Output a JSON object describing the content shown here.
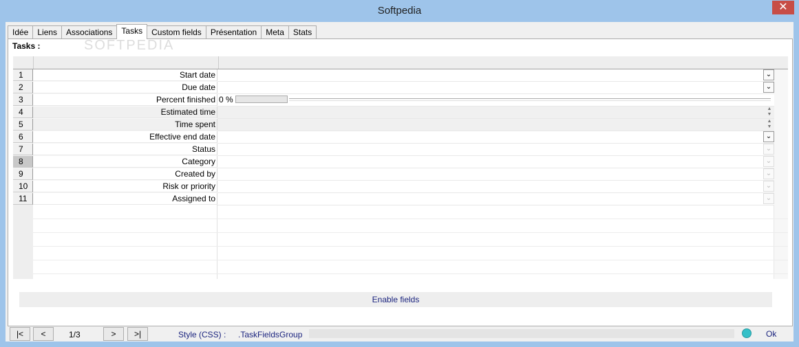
{
  "window": {
    "title": "Softpedia",
    "close": "✕"
  },
  "watermark": "SOFTPEDIA",
  "tabs": [
    {
      "label": "Idée"
    },
    {
      "label": "Liens"
    },
    {
      "label": "Associations"
    },
    {
      "label": "Tasks",
      "active": true
    },
    {
      "label": "Custom fields"
    },
    {
      "label": "Présentation"
    },
    {
      "label": "Meta"
    },
    {
      "label": "Stats"
    }
  ],
  "panel": {
    "title": "Tasks :"
  },
  "rows": [
    {
      "num": "1",
      "label": "Start date",
      "control": "dropdown"
    },
    {
      "num": "2",
      "label": "Due date",
      "control": "dropdown"
    },
    {
      "num": "3",
      "label": "Percent finished",
      "control": "percent",
      "value": "0 %"
    },
    {
      "num": "4",
      "label": "Estimated time",
      "control": "spin",
      "grey": true
    },
    {
      "num": "5",
      "label": "Time spent",
      "control": "spin",
      "grey": true
    },
    {
      "num": "6",
      "label": "Effective end date",
      "control": "dropdown"
    },
    {
      "num": "7",
      "label": "Status",
      "control": "dropdown-disabled"
    },
    {
      "num": "8",
      "label": "Category",
      "control": "dropdown-disabled",
      "selected": true
    },
    {
      "num": "9",
      "label": "Created by",
      "control": "dropdown-disabled"
    },
    {
      "num": "10",
      "label": "Risk or priority",
      "control": "dropdown-disabled"
    },
    {
      "num": "11",
      "label": "Assigned to",
      "control": "dropdown-disabled"
    }
  ],
  "enable_button": "Enable fields",
  "nav": {
    "first": "|<",
    "prev": "<",
    "page": "1/3",
    "next": ">",
    "last": ">|",
    "style_label": "Style (CSS) :",
    "style_value": ".TaskFieldsGroup",
    "status": "Ok",
    "status_color": "#35c0c8"
  }
}
